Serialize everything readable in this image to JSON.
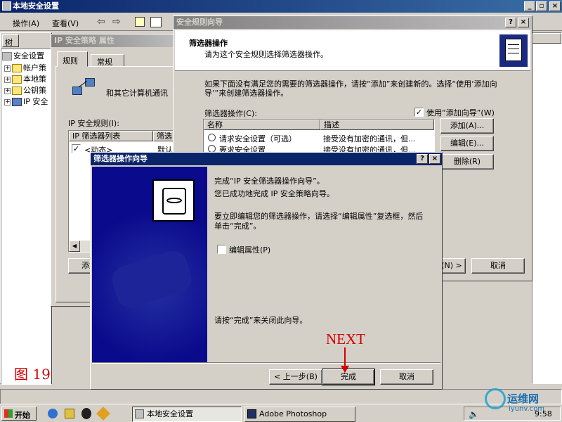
{
  "main_window": {
    "title": "本地安全设置",
    "menu": [
      "操作(A)",
      "查看(V)"
    ],
    "tree_tab": "树",
    "tree_items": [
      "安全设置",
      "帐户策",
      "本地策",
      "公钥策",
      "IP 安全"
    ]
  },
  "policy_props": {
    "title": "IP 安全策略 属性",
    "tabs": [
      "规则",
      "常规"
    ],
    "description": "和其它计算机通讯",
    "rules_label": "IP 安全规则(I):",
    "columns": [
      "IP 筛选器列表",
      "筛选"
    ],
    "rows": [
      {
        "name": "<动态>",
        "value": "默认"
      }
    ],
    "add_button": "添加"
  },
  "rule_wizard": {
    "title": "安全规则向导",
    "heading": "筛选器操作",
    "subheading": "请为这个安全规则选择筛选器操作。",
    "instructions": "如果下面没有满足您的需要的筛选器操作，请按“添加”来创建新的。选择“使用‘添加向导’”来创建筛选器操作。",
    "list_label": "筛选器操作(C):",
    "use_wizard": "使用“添加向导”(W)",
    "columns": [
      "名称",
      "描述"
    ],
    "rows": [
      {
        "name": "请求安全设置（可选）",
        "desc": "接受没有加密的通讯，但..."
      },
      {
        "name": "要求安全设置",
        "desc": "接受没有加密的通讯，但..."
      }
    ],
    "buttons": {
      "add": "添加(A)...",
      "edit": "编辑(E)...",
      "remove": "删除(R)",
      "next": "(N) >",
      "cancel": "取消"
    }
  },
  "filter_wizard": {
    "title": "筛选器操作向导",
    "line1": "完成“IP 安全筛选器操作向导”。",
    "line2": "您已成功地完成 IP 安全策略向导。",
    "line3": "要立即编辑您的筛选器操作，请选择“编辑属性”复选框，然后单击“完成”。",
    "edit_props": "编辑属性(P)",
    "close_hint": "请按“完成”来关闭此向导。",
    "buttons": {
      "back": "< 上一步(B)",
      "finish": "完成",
      "cancel": "取消"
    }
  },
  "annotations": {
    "figure_label": "图 19",
    "next_label": "NEXT",
    "color": "#d40000"
  },
  "taskbar": {
    "start": "开始",
    "tasks": [
      "本地安全设置",
      "Adobe Photoshop"
    ],
    "time": "9:58"
  },
  "watermark": {
    "name": "运维网",
    "site": "iyunv.com"
  }
}
